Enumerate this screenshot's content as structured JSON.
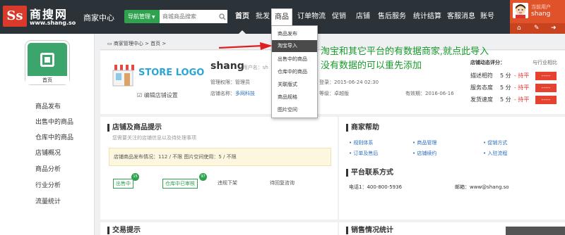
{
  "header": {
    "logo_mark": "Ss",
    "logo_cn": "商搜网",
    "logo_url": "www.shang.so",
    "center_title": "商家中心",
    "nav_button": "导航管理",
    "search_placeholder": "商城商品搜索",
    "nav_items": [
      "首页",
      "批发",
      "商品",
      "订单物流",
      "促销",
      "店铺",
      "售后服务",
      "统计结算",
      "客服消息",
      "账号"
    ],
    "user": {
      "role": "当前用户",
      "name": "shang"
    }
  },
  "sidebar": {
    "tile_label": "首页",
    "items": [
      "商品发布",
      "出售中的商品",
      "仓库中的商品",
      "店铺概况",
      "商品分析",
      "行业分析",
      "流量统计"
    ]
  },
  "breadcrumb": "商家管理中心 > 首页 >",
  "store": {
    "logo_text": "STORE LOGO",
    "edit_label": "编辑店铺设置",
    "name": "shang",
    "user_meta": "(用户名：sh",
    "permission": "管理权限：管理员",
    "store_label": "店铺名称：",
    "store_link": "多网科技",
    "last_login": "登录：2015-06-24 02:30",
    "level": "等级：卓越版",
    "expire": "有效期：2016-06-16",
    "rating_title": "店铺动态评分：",
    "rating_compare": "与行业相比",
    "ratings": [
      {
        "label": "描述相符",
        "score": "5 分",
        "status": "- 持平",
        "badge": "-----"
      },
      {
        "label": "服务态度",
        "score": "5 分",
        "status": "- 持平",
        "badge": "-----"
      },
      {
        "label": "发货速度",
        "score": "5 分",
        "status": "- 持平",
        "badge": "-----"
      }
    ]
  },
  "tips_panel": {
    "title": "店铺及商品提示",
    "subtitle": "您需要关注的店铺信息以及待处理事项",
    "stats": "店铺商品发布情况：112 / 不限     图片空间使用：5 / 不限",
    "tags": [
      {
        "label": "出售中",
        "count": "15"
      },
      {
        "label": "仓库中已审核",
        "count": "97"
      },
      {
        "label": "违规下架",
        "count": ""
      },
      {
        "label": "待回复咨询",
        "count": ""
      }
    ]
  },
  "help_panel": {
    "title": "商家帮助",
    "links": [
      "规则体系",
      "商品管理",
      "促销方式",
      "订单及售后",
      "店铺续约",
      "入驻流程"
    ],
    "contact_title": "平台联系方式",
    "phone": "电话1：400-800-5936",
    "email": "邮箱：www@shang.so"
  },
  "bottom": {
    "trade_title": "交易提示",
    "sales_title": "销售情况统计"
  },
  "dropdown": {
    "items": [
      "商品发布",
      "淘宝导入",
      "出售中的商品",
      "仓库中的商品",
      "关联版式",
      "商品规格",
      "图片空间"
    ],
    "selected_index": 1
  },
  "annotation": {
    "line1": "淘宝和其它平台的有数据商家,就点此导入",
    "line2": "没有数据的可以重先添加"
  },
  "colors": {
    "topbar": "#2c3338",
    "accent_green": "#2ea24d",
    "user_orange": "#e0532a",
    "annotation_green": "#1a9a2c",
    "arrow_red": "#e02020"
  }
}
